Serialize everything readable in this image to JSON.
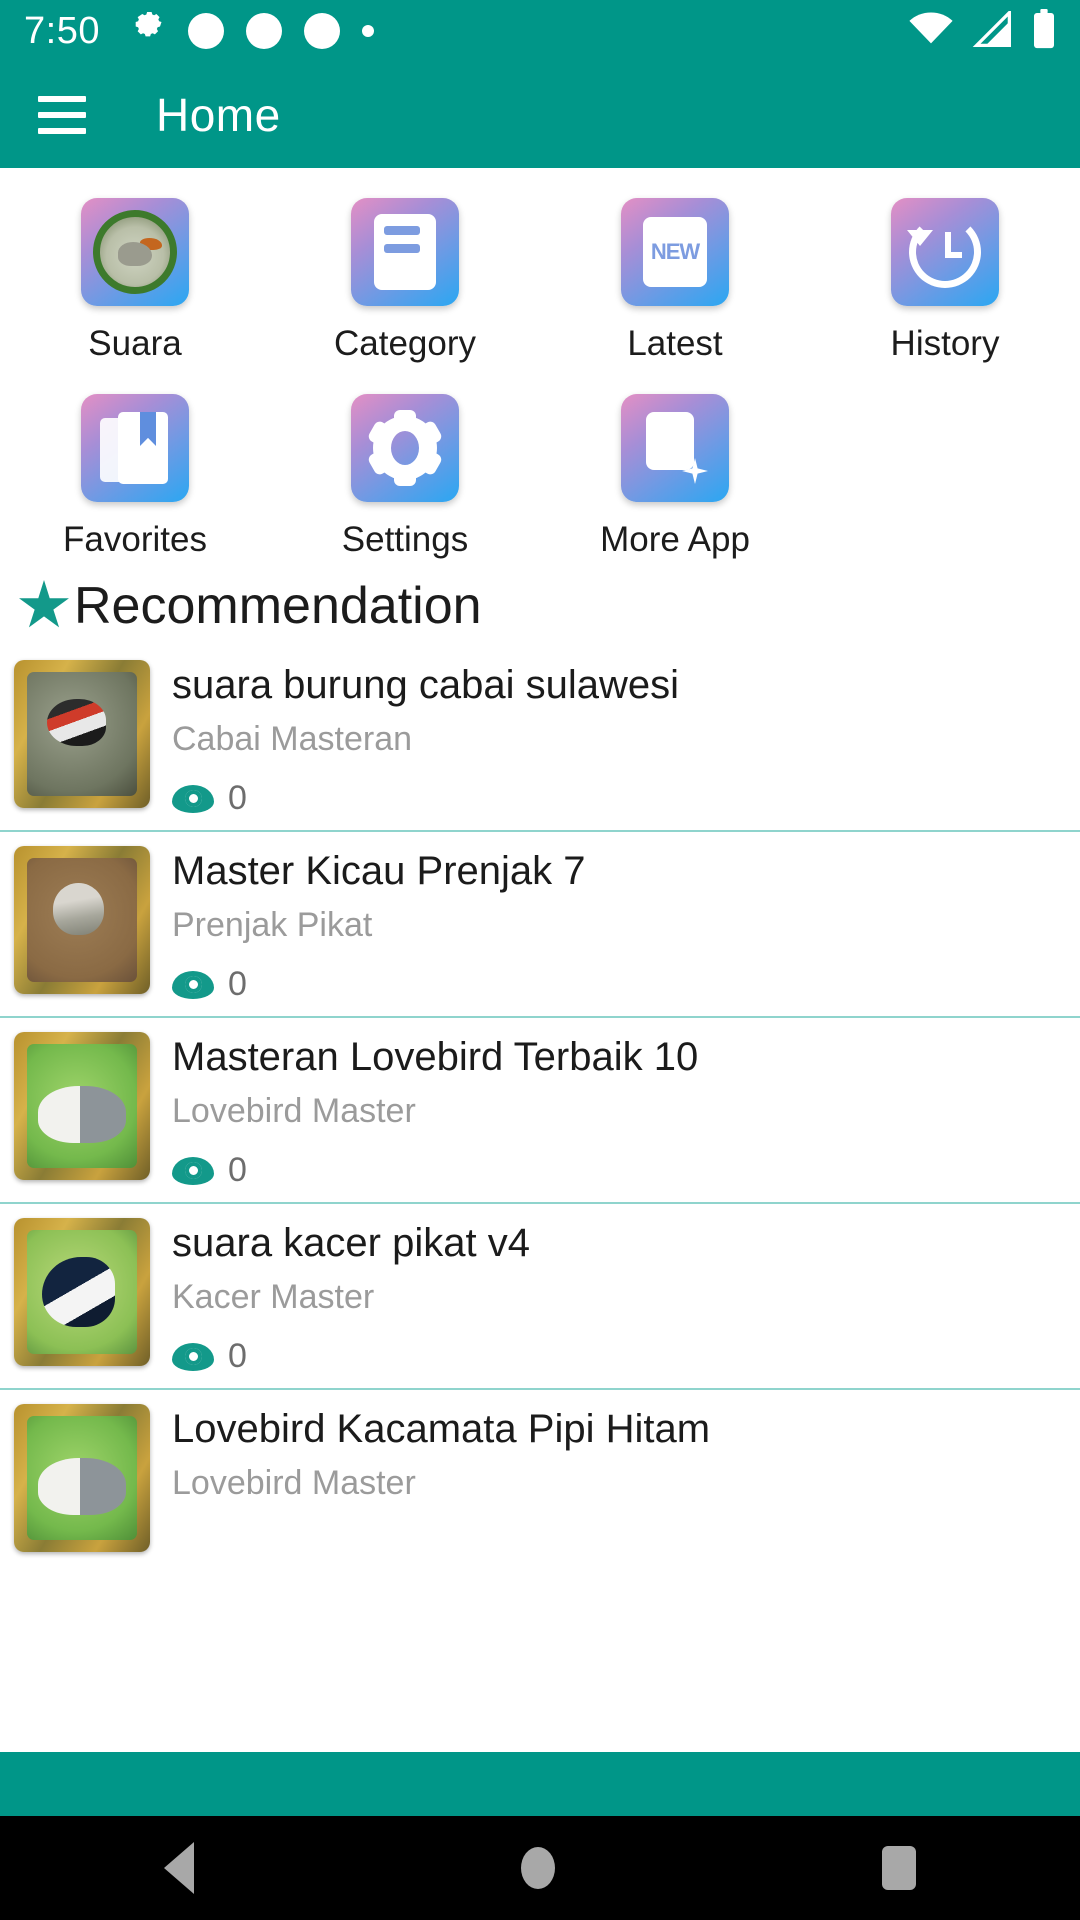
{
  "statusbar": {
    "time": "7:50",
    "left_icons": [
      "gear-icon",
      "circle-icon",
      "circle-icon",
      "circle-icon",
      "dot-icon"
    ],
    "right_icons": [
      "wifi-icon",
      "cellular-signal-icon",
      "battery-icon"
    ]
  },
  "appbar": {
    "menu_icon": "hamburger-menu-icon",
    "title": "Home",
    "background_color": "#009688"
  },
  "grid": {
    "rows": [
      [
        {
          "label": "Suara",
          "icon": "bird-photo-icon"
        },
        {
          "label": "Category",
          "icon": "category-card-icon"
        },
        {
          "label": "Latest",
          "icon": "new-badge-icon"
        },
        {
          "label": "History",
          "icon": "clock-history-icon"
        }
      ],
      [
        {
          "label": "Favorites",
          "icon": "bookmark-library-icon"
        },
        {
          "label": "Settings",
          "icon": "gear-icon"
        },
        {
          "label": "More App",
          "icon": "app-sparkle-icon"
        }
      ]
    ],
    "latest_badge_text": "NEW"
  },
  "section": {
    "icon": "star-icon",
    "title": "Recommendation",
    "accent_color": "#13998a"
  },
  "list": {
    "items": [
      {
        "title": "suara burung cabai sulawesi",
        "subtitle": "Cabai Masteran",
        "views": "0",
        "thumb": "bird-cabai-thumb"
      },
      {
        "title": "Master Kicau Prenjak 7",
        "subtitle": "Prenjak Pikat",
        "views": "0",
        "thumb": "bird-prenjak-thumb"
      },
      {
        "title": "Masteran Lovebird Terbaik 10",
        "subtitle": "Lovebird Master",
        "views": "0",
        "thumb": "lovebird-thumb"
      },
      {
        "title": "suara kacer pikat v4",
        "subtitle": "Kacer Master",
        "views": "0",
        "thumb": "bird-kacer-thumb"
      },
      {
        "title": "Lovebird Kacamata Pipi Hitam",
        "subtitle": "Lovebird Master",
        "views": "",
        "thumb": "lovebird-thumb"
      }
    ],
    "views_icon": "eye-icon"
  },
  "navbar": {
    "back": "back-triangle-icon",
    "home": "home-circle-icon",
    "recents": "recents-square-icon"
  }
}
